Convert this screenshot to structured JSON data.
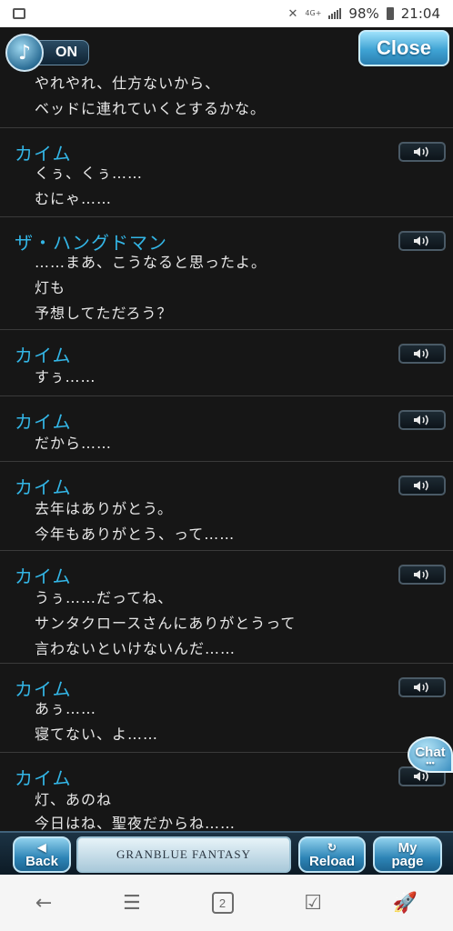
{
  "status_bar": {
    "battery": "98%",
    "time": "21:04",
    "network": "4G+"
  },
  "top": {
    "sound_state": "ON",
    "close_label": "Close"
  },
  "log": [
    {
      "speaker": "",
      "lines": [
        "やれやれ、仕方ないから、",
        "ベッドに連れていくとするかな。"
      ]
    },
    {
      "speaker": "カイム",
      "lines": [
        "くぅ、くぅ……",
        "むにゃ……"
      ]
    },
    {
      "speaker": "ザ・ハングドマン",
      "lines": [
        "……まあ、こうなると思ったよ。",
        "灯も",
        "予想してただろう？"
      ]
    },
    {
      "speaker": "カイム",
      "lines": [
        "すぅ……"
      ]
    },
    {
      "speaker": "カイム",
      "lines": [
        "だから……"
      ]
    },
    {
      "speaker": "カイム",
      "lines": [
        "去年はありがとう。",
        "今年もありがとう、って……"
      ]
    },
    {
      "speaker": "カイム",
      "lines": [
        "うぅ……だってね、",
        "サンタクロースさんにありがとうって",
        "言わないといけないんだ……"
      ]
    },
    {
      "speaker": "カイム",
      "lines": [
        "あぅ……",
        "寝てない、よ……"
      ]
    },
    {
      "speaker": "カイム",
      "lines": [
        "灯、あのね",
        "今日はね、聖夜だからね……"
      ]
    }
  ],
  "chat_label": "Chat",
  "footer": {
    "back_label": "Back",
    "banner_text": "GRANBLUE FANTASY",
    "reload_label": "Reload",
    "mypage_line1": "My",
    "mypage_line2": "page"
  },
  "nav": {
    "tabs_count": "2"
  }
}
